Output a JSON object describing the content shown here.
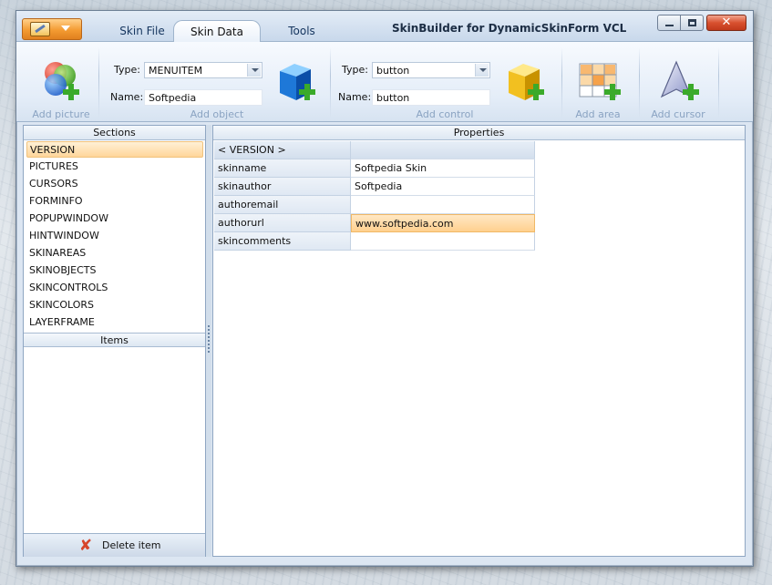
{
  "window": {
    "title": "SkinBuilder for DynamicSkinForm VCL",
    "close_glyph": "✕"
  },
  "tabs": [
    {
      "label": "Skin File"
    },
    {
      "label": "Skin Data"
    },
    {
      "label": "Tools"
    }
  ],
  "ribbon": {
    "add_picture_label": "Add picture",
    "add_object_label": "Add object",
    "add_control_label": "Add control",
    "add_area_label": "Add area",
    "add_cursor_label": "Add cursor",
    "object": {
      "type_label": "Type:",
      "type_value": "MENUITEM",
      "name_label": "Name:",
      "name_value": "Softpedia"
    },
    "control": {
      "type_label": "Type:",
      "type_value": "button",
      "name_label": "Name:",
      "name_value": "button"
    }
  },
  "sections": {
    "header": "Sections",
    "selected": "VERSION",
    "items": [
      "VERSION",
      "PICTURES",
      "CURSORS",
      "FORMINFO",
      "POPUPWINDOW",
      "HINTWINDOW",
      "SKINAREAS",
      "SKINOBJECTS",
      "SKINCONTROLS",
      "SKINCOLORS",
      "LAYERFRAME"
    ]
  },
  "items": {
    "header": "Items",
    "delete_label": "Delete item",
    "delete_glyph": "✘"
  },
  "properties": {
    "header": "Properties",
    "group_label": "< VERSION >",
    "rows": [
      {
        "key": "skinname",
        "value": "Softpedia Skin"
      },
      {
        "key": "skinauthor",
        "value": "Softpedia"
      },
      {
        "key": "authoremail",
        "value": ""
      },
      {
        "key": "authorurl",
        "value": "www.softpedia.com"
      },
      {
        "key": "skincomments",
        "value": ""
      }
    ],
    "selected_key": "authorurl"
  },
  "colors": {
    "accent": "#f49b32",
    "selection": "#ffd69a",
    "ribbon_caption": "#8aa3c2"
  }
}
